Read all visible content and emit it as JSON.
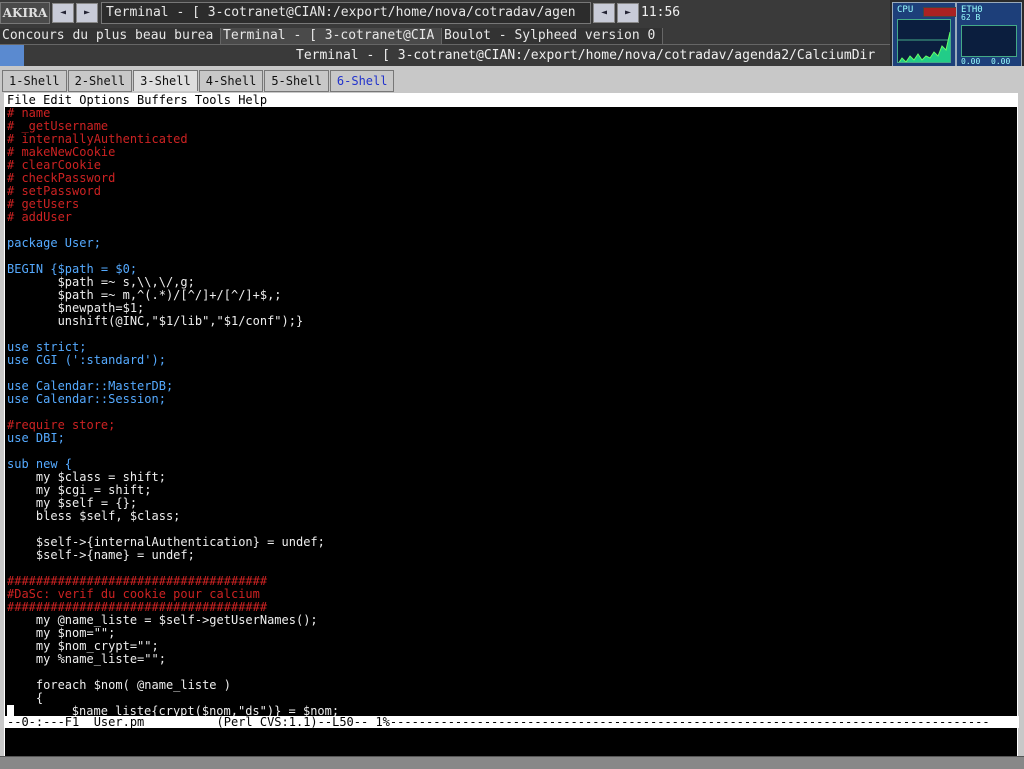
{
  "panel": {
    "app_label": "AKIRA",
    "tasks": [
      "Terminal - [ 3-cotranet@CIAN:/export/home/nova/cotradav/agen"
    ],
    "clock": "11:56",
    "tasks_row2": [
      "Concours du plus beau burea",
      "Terminal - [ 3-cotranet@CIA",
      "Boulot - Sylpheed version 0"
    ]
  },
  "monitors": {
    "cpu_label": "CPU",
    "net_label": "ETH0",
    "net_in": "62 B",
    "net_out": "0.00",
    "net_out2": "0.00"
  },
  "window": {
    "title": "Terminal - [ 3-cotranet@CIAN:/export/home/nova/cotradav/agenda2/CalciumDir"
  },
  "tabs": [
    "1-Shell",
    "2-Shell",
    "3-Shell",
    "4-Shell",
    "5-Shell",
    "6-Shell"
  ],
  "editor": {
    "menu": "File Edit Options Buffers Tools Help",
    "lines": [
      "# name",
      "# _getUsername",
      "# internallyAuthenticated",
      "# makeNewCookie",
      "# clearCookie",
      "# checkPassword",
      "# setPassword",
      "# getUsers",
      "# addUser",
      "",
      "package User;",
      "",
      "BEGIN {$path = $0;",
      "       $path =~ s,\\\\,\\/,g;",
      "       $path =~ m,^(.*)/[^/]+/[^/]+$,;",
      "       $newpath=$1;",
      "       unshift(@INC,\"$1/lib\",\"$1/conf\");}",
      "",
      "use strict;",
      "use CGI (':standard');",
      "",
      "use Calendar::MasterDB;",
      "use Calendar::Session;",
      "",
      "#require store;",
      "use DBI;",
      "",
      "sub new {",
      "    my $class = shift;",
      "    my $cgi = shift;",
      "    my $self = {};",
      "    bless $self, $class;",
      "",
      "    $self->{internalAuthentication} = undef;",
      "    $self->{name} = undef;",
      "",
      "####################################",
      "#DaSc: verif du cookie pour calcium",
      "####################################",
      "    my @name_liste = $self->getUserNames();",
      "    my $nom=\"\";",
      "    my $nom_crypt=\"\";",
      "    my %name_liste=\"\";",
      "",
      "    foreach $nom( @name_liste )",
      "    {",
      "        $name_liste{crypt($nom,\"ds\")} = $nom;"
    ],
    "status": "--0-:---F1  User.pm          (Perl CVS:1.1)--L50-- 1%-----------------------------------------------------------------------------------"
  }
}
